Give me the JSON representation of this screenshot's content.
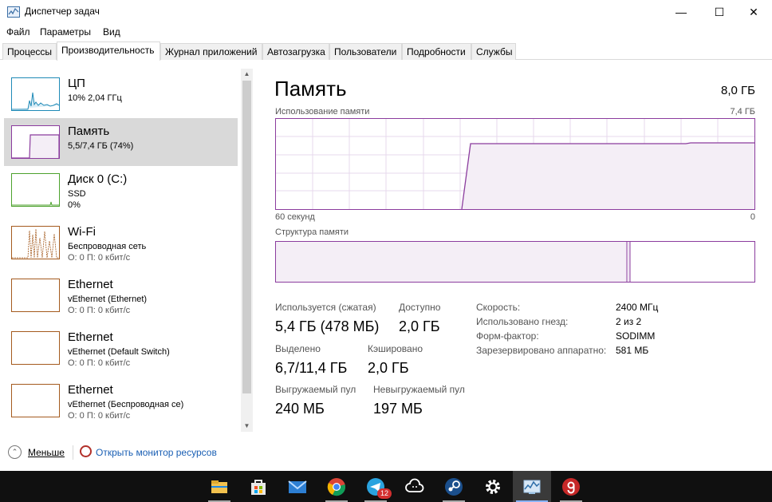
{
  "window": {
    "title": "Диспетчер задач",
    "minimize_glyph": "—",
    "maximize_glyph": "☐",
    "close_glyph": "✕"
  },
  "menu": [
    "Файл",
    "Параметры",
    "Вид"
  ],
  "tabs": [
    "Процессы",
    "Производительность",
    "Журнал приложений",
    "Автозагрузка",
    "Пользователи",
    "Подробности",
    "Службы"
  ],
  "active_tab": "Производительность",
  "sidebar": {
    "items": [
      {
        "name": "ЦП",
        "line1": "10% 2,04 ГГц",
        "line2": "",
        "color": "#1f8ab7"
      },
      {
        "name": "Память",
        "line1": "5,5/7,4 ГБ (74%)",
        "line2": "",
        "color": "#8b3c9e"
      },
      {
        "name": "Диск 0 (C:)",
        "line1": "SSD",
        "line2": "0%",
        "color": "#4da22d"
      },
      {
        "name": "Wi-Fi",
        "line1": "Беспроводная сеть",
        "line2": "О: 0 П: 0 кбит/с",
        "color": "#a45a1e"
      },
      {
        "name": "Ethernet",
        "line1": "vEthernet (Ethernet)",
        "line2": "О: 0 П: 0 кбит/с",
        "color": "#a45a1e"
      },
      {
        "name": "Ethernet",
        "line1": "vEthernet (Default Switch)",
        "line2": "О: 0 П: 0 кбит/с",
        "color": "#a45a1e"
      },
      {
        "name": "Ethernet",
        "line1": "vEthernet (Беспроводная се)",
        "line2": "О: 0 П: 0 кбит/с",
        "color": "#a45a1e"
      }
    ],
    "selected_index": 1,
    "scroll_up": "▲",
    "scroll_down": "▼"
  },
  "memory": {
    "title": "Память",
    "total": "8,0 ГБ",
    "usage_caption": "Использование памяти",
    "usage_max": "7,4 ГБ",
    "time_left": "60 секунд",
    "time_right": "0",
    "composition_caption": "Структура памяти",
    "usage_fraction": 0.74,
    "color": "#8b3c9e",
    "fill": "#f4eef6",
    "stats": {
      "in_use_label": "Используется (сжатая)",
      "in_use_value": "5,4 ГБ (478 МБ)",
      "available_label": "Доступно",
      "available_value": "2,0 ГБ",
      "committed_label": "Выделено",
      "committed_value": "6,7/11,4 ГБ",
      "cached_label": "Кэшировано",
      "cached_value": "2,0 ГБ",
      "paged_label": "Выгружаемый пул",
      "paged_value": "240 МБ",
      "nonpaged_label": "Невыгружаемый пул",
      "nonpaged_value": "197 МБ"
    },
    "details": [
      {
        "label": "Скорость:",
        "value": "2400 МГц"
      },
      {
        "label": "Использовано гнезд:",
        "value": "2 из 2"
      },
      {
        "label": "Форм-фактор:",
        "value": "SODIMM"
      },
      {
        "label": "Зарезервировано аппаратно:",
        "value": "581 МБ"
      }
    ]
  },
  "footer": {
    "less_icon": "⌃",
    "less_label": "Меньше",
    "monitor_link": "Открыть монитор ресурсов"
  },
  "taskbar": {
    "apps": [
      {
        "icon": "file-explorer-icon",
        "color": "#f2c14e"
      },
      {
        "icon": "store-icon",
        "color": "#e8e8e8"
      },
      {
        "icon": "mail-icon",
        "color": "#2d7fd3"
      },
      {
        "icon": "chrome-icon",
        "color": "#db4437"
      },
      {
        "icon": "telegram-icon",
        "color": "#2aa3df",
        "badge": "12"
      },
      {
        "icon": "cloud-app-icon",
        "color": "#ffffff"
      },
      {
        "icon": "steam-icon",
        "color": "#1b4f8c"
      },
      {
        "icon": "settings-icon",
        "color": "#ffffff"
      },
      {
        "icon": "task-manager-icon",
        "color": "#9cc3e6",
        "active": true
      },
      {
        "icon": "app-g-icon",
        "color": "#c62828"
      }
    ]
  }
}
